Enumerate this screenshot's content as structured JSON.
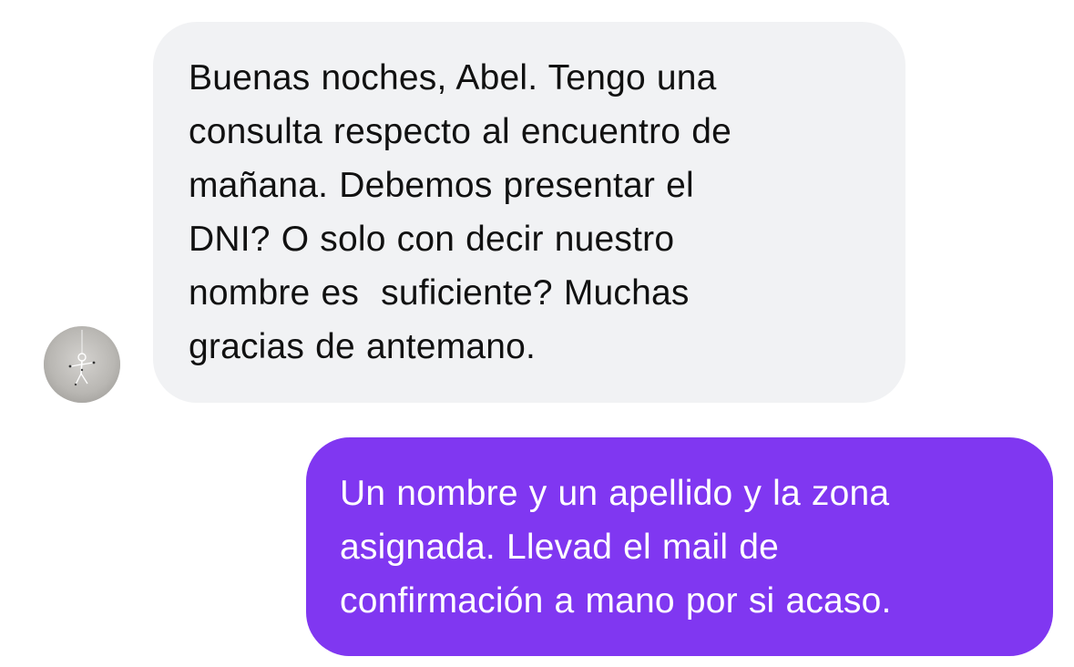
{
  "conversation": {
    "incoming": {
      "avatar_icon": "user-avatar-photo",
      "bubble_color": "#f1f2f4",
      "lines": [
        "Buenas noches, Abel. Tengo una",
        "consulta respecto al encuentro de",
        "mañana. Debemos presentar el",
        "DNI? O solo con decir nuestro",
        "nombre es  suficiente? Muchas",
        "gracias de antemano."
      ]
    },
    "outgoing": {
      "bubble_color": "#8037f1",
      "lines": [
        "Un nombre y un apellido y la zona",
        "asignada. Llevad el mail de",
        "confirmación a mano por si acaso."
      ]
    }
  }
}
